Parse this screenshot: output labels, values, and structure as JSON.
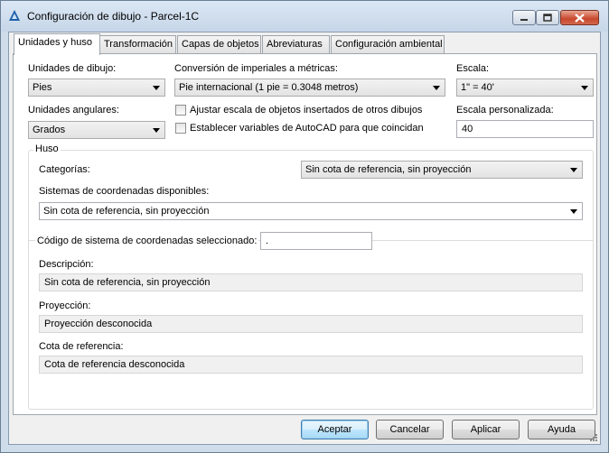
{
  "window": {
    "title": "Configuración de dibujo - Parcel-1C"
  },
  "tabs": [
    {
      "label": "Unidades y huso",
      "active": true
    },
    {
      "label": "Transformación"
    },
    {
      "label": "Capas de objetos"
    },
    {
      "label": "Abreviaturas"
    },
    {
      "label": "Configuración ambiental"
    }
  ],
  "units": {
    "drawing_units_label": "Unidades de dibujo:",
    "drawing_units_value": "Pies",
    "conversion_label": "Conversión de imperiales a métricas:",
    "conversion_value": "Pie internacional (1 pie = 0.3048 metros)",
    "scale_label": "Escala:",
    "scale_value": "1\" = 40'",
    "angular_label": "Unidades angulares:",
    "angular_value": "Grados",
    "scale_inserted_label": "Ajustar escala de objetos insertados de otros dibujos",
    "set_autocad_vars_label": "Establecer variables de AutoCAD para que coincidan",
    "custom_scale_label": "Escala personalizada:",
    "custom_scale_value": "40"
  },
  "zone": {
    "legend": "Huso",
    "categories_label": "Categorías:",
    "categories_value": "Sin cota de referencia, sin proyección",
    "available_label": "Sistemas de coordenadas disponibles:",
    "available_value": "Sin cota de referencia, sin proyección",
    "selected_code_label": "Código de sistema de coordenadas seleccionado:",
    "selected_code_value": ".",
    "description_label": "Descripción:",
    "description_value": "Sin cota de referencia, sin proyección",
    "projection_label": "Proyección:",
    "projection_value": "Proyección desconocida",
    "datum_label": "Cota de referencia:",
    "datum_value": "Cota de referencia desconocida"
  },
  "buttons": {
    "ok": "Aceptar",
    "cancel": "Cancelar",
    "apply": "Aplicar",
    "help": "Ayuda"
  },
  "colors": {
    "title_bar": "#c6d6e8",
    "close_button": "#c8472d",
    "default_button": "#3c7fb1"
  }
}
